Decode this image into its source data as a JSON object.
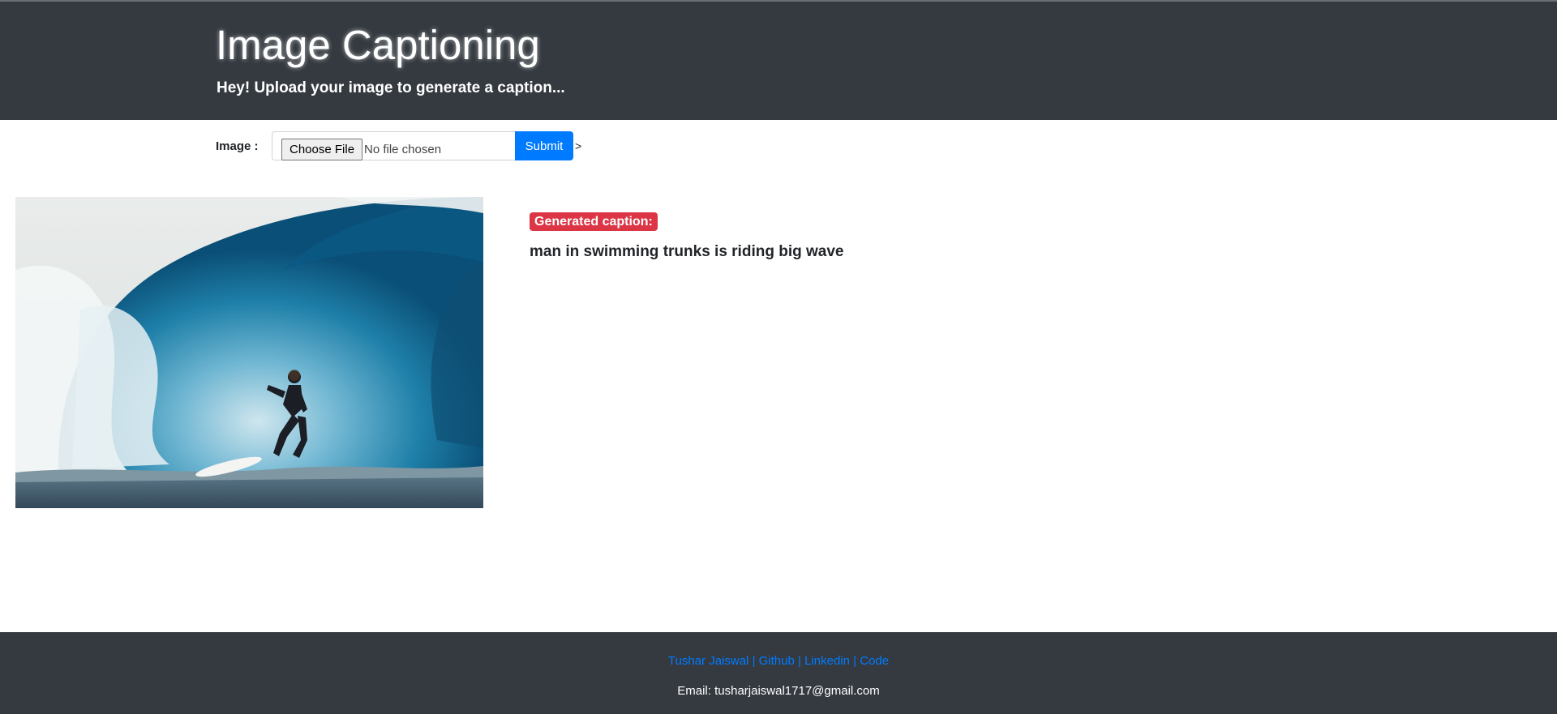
{
  "header": {
    "title": "Image Captioning",
    "subtitle": "Hey! Upload your image to generate a caption..."
  },
  "form": {
    "label": "Image :",
    "choose_file_label": "Choose File",
    "file_status": "No file chosen",
    "submit_label": "Submit",
    "stray_text": ">"
  },
  "result": {
    "badge": "Generated caption:",
    "caption": "man in swimming trunks is riding big wave",
    "image_alt": "surfer riding inside a large blue wave"
  },
  "footer": {
    "links": [
      "Tushar Jaiswal",
      "Github",
      "Linkedin",
      "Code"
    ],
    "separator": "|",
    "email": "Email: tusharjaiswal1717@gmail.com"
  },
  "colors": {
    "header_bg": "#343a40",
    "primary": "#007bff",
    "danger": "#dc3545"
  }
}
